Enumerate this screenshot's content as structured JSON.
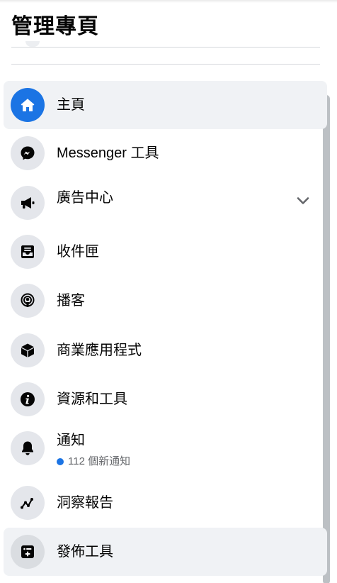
{
  "header": {
    "title": "管理專頁"
  },
  "nav": {
    "home": {
      "label": "主頁",
      "icon": "home-icon"
    },
    "messenger": {
      "label": "Messenger 工具",
      "icon": "messenger-icon"
    },
    "ads": {
      "label": "廣告中心",
      "icon": "megaphone-icon"
    },
    "inbox": {
      "label": "收件匣",
      "icon": "inbox-icon"
    },
    "podcast": {
      "label": "播客",
      "icon": "podcast-icon"
    },
    "business_apps": {
      "label": "商業應用程式",
      "icon": "cube-icon"
    },
    "resources": {
      "label": "資源和工具",
      "icon": "info-icon"
    },
    "notifications": {
      "label": "通知",
      "count_text": "112 個新通知",
      "icon": "bell-icon"
    },
    "insights": {
      "label": "洞察報告",
      "icon": "trend-icon"
    },
    "publishing": {
      "label": "發佈工具",
      "icon": "publishing-tools-icon"
    }
  },
  "colors": {
    "accent": "#1b74e4",
    "active_bg": "#f0f2f5",
    "icon_bg": "#e4e6eb",
    "secondary_text": "#65676b"
  }
}
